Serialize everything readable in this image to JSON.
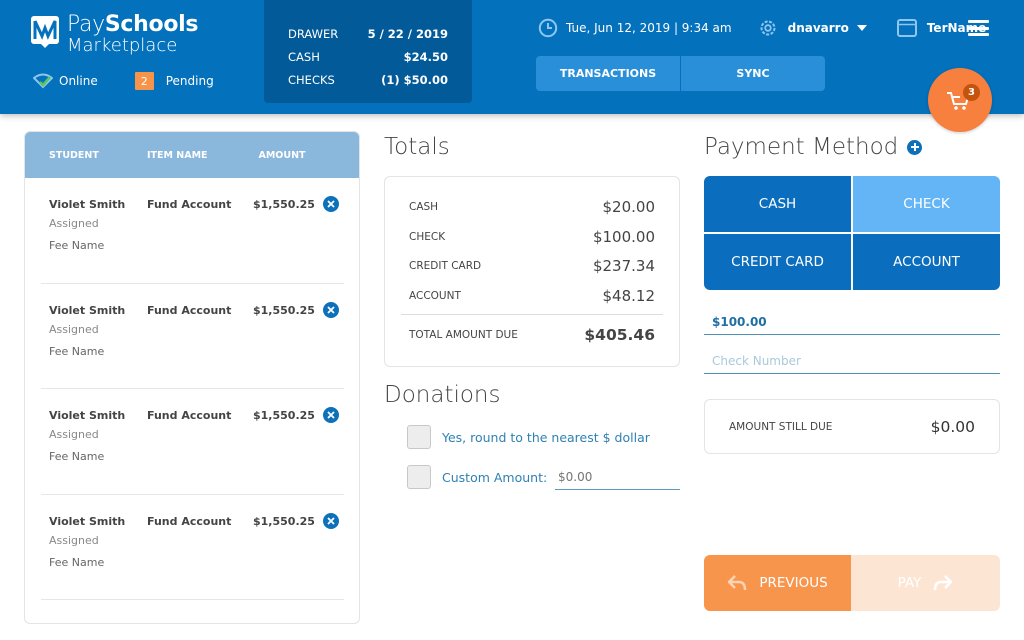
{
  "header": {
    "brand_pay": "Pay",
    "brand_schools": "Schools",
    "brand_marketplace": "Marketplace",
    "status_online": "Online",
    "pending_count": "2",
    "pending_label": "Pending",
    "drawer": [
      {
        "label": "DRAWER",
        "value": "5 / 22 / 2019"
      },
      {
        "label": "CASH",
        "value": "$24.50"
      },
      {
        "label": "CHECKS",
        "value": "(1) $50.00"
      }
    ],
    "datetime": "Tue, Jun 12, 2019 | 9:34 am",
    "username": "dnavarro",
    "terminal": "TerName",
    "tabs": [
      "TRANSACTIONS",
      "SYNC"
    ],
    "cart_count": "3"
  },
  "cart_list": {
    "columns": [
      "STUDENT",
      "ITEM NAME",
      "AMOUNT"
    ],
    "rows": [
      {
        "student": "Violet Smith",
        "status": "Assigned",
        "fee": "Fee Name",
        "item": "Fund Account",
        "amount": "$1,550.25"
      },
      {
        "student": "Violet Smith",
        "status": "Assigned",
        "fee": "Fee Name",
        "item": "Fund Account",
        "amount": "$1,550.25"
      },
      {
        "student": "Violet Smith",
        "status": "Assigned",
        "fee": "Fee Name",
        "item": "Fund Account",
        "amount": "$1,550.25"
      },
      {
        "student": "Violet Smith",
        "status": "Assigned",
        "fee": "Fee Name",
        "item": "Fund Account",
        "amount": "$1,550.25"
      }
    ]
  },
  "totals": {
    "title": "Totals",
    "rows": [
      {
        "label": "CASH",
        "value": "$20.00"
      },
      {
        "label": "CHECK",
        "value": "$100.00"
      },
      {
        "label": "CREDIT CARD",
        "value": "$237.34"
      },
      {
        "label": "ACCOUNT",
        "value": "$48.12"
      }
    ],
    "total_label": "TOTAL AMOUNT DUE",
    "total_value": "$405.46"
  },
  "donations": {
    "title": "Donations",
    "round_label": "Yes, round to the nearest $ dollar",
    "custom_label": "Custom Amount:",
    "custom_placeholder": "$0.00"
  },
  "payment": {
    "title": "Payment Method",
    "methods": [
      "CASH",
      "CHECK",
      "CREDIT CARD",
      "ACCOUNT"
    ],
    "selected": "CHECK",
    "amount_value": "$100.00",
    "check_number_placeholder": "Check Number",
    "still_due_label": "AMOUNT STILL DUE",
    "still_due_value": "$0.00",
    "previous_label": "PREVIOUS",
    "pay_label": "PAY"
  }
}
